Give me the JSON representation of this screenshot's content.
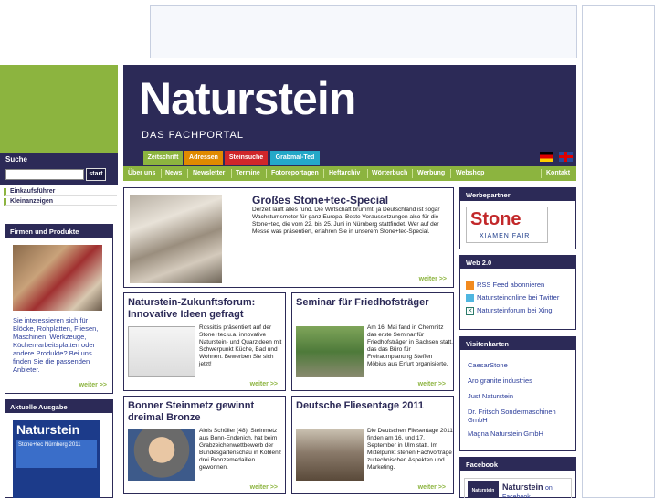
{
  "header": {
    "logo": "Naturstein",
    "subtitle": "DAS FACHPORTAL",
    "tabs": [
      {
        "label": "Zeitschrift",
        "color": "#8cb43f"
      },
      {
        "label": "Adressen",
        "color": "#e08a00"
      },
      {
        "label": "Steinsuche",
        "color": "#d0262a"
      },
      {
        "label": "Grabmal-Ted",
        "color": "#24a8c8"
      }
    ]
  },
  "nav": {
    "items": [
      "Über uns",
      "News",
      "Newsletter",
      "Termine",
      "Fotoreportagen",
      "Heftarchiv",
      "Wörterbuch",
      "Werbung",
      "Webshop"
    ],
    "contact": "Kontakt"
  },
  "left": {
    "search_title": "Suche",
    "search_button": "start",
    "quick_links": [
      "Einkaufsführer",
      "Kleinanzeigen"
    ],
    "firmen_title": "Firmen und Produkte",
    "firmen_text": "Sie interessieren sich für Blöcke, Rohplatten, Fliesen, Maschinen, Werkzeuge, Küchen-arbeitsplatten oder andere Produkte? Bei uns finden Sie die passenden Anbieter.",
    "firmen_more": "weiter >>",
    "ausgabe_title": "Aktuelle Ausgabe",
    "cover_title": "Naturstein",
    "cover_sub": "Stone+tec Nürnberg 2011"
  },
  "articles": {
    "feature": {
      "title": "Großes Stone+tec-Special",
      "text": "Derzeit läuft alles rund. Die Wirtschaft brummt, ja Deutschland ist sogar Wachstumsmotor für ganz Europa. Beste Voraussetzungen also für die Stone+tec, die vom 22. bis 25. Juni in Nürnberg stattfindet. Wer auf der Messe was präsentiert, erfahren Sie in unserem Stone+tec-Special.",
      "more": "weiter >>"
    },
    "cards": [
      {
        "title": "Naturstein-Zukunftsforum: Innovative Ideen gefragt",
        "text": "Rossittis präsentiert auf der Stone+tec u.a. innovative Naturstein- und Quarzideen mit Schwerpunkt Küche, Bad und Wohnen. Bewerben Sie sich jetzt!",
        "more": "weiter >>"
      },
      {
        "title": "Seminar für Friedhofsträger",
        "text": "Am 16. Mai fand in Chemnitz das erste Seminar für Friedhofsträger in Sachsen statt, das das Büro für Freiraumplanung Steffen Möbius aus Erfurt organisierte.",
        "more": "weiter >>"
      },
      {
        "title": "Bonner Steinmetz gewinnt dreimal Bronze",
        "text": "Alois Schüller (48), Steinmetz aus Bonn-Endenich, hat beim Grabzeichenwettbewerb der Bundesgartenschau in Koblenz drei Bronzemedaillen gewonnen.",
        "more": "weiter >>"
      },
      {
        "title": "Deutsche Fliesentage 2011",
        "text": "Die Deutschen Fliesentage 2011 finden am 16. und 17. September in Ulm statt. Im Mittelpunkt stehen Fachvorträge zu technischen Aspekten und Marketing.",
        "more": "weiter >>"
      }
    ]
  },
  "right": {
    "werbe_title": "Werbepartner",
    "stone_logo": "Stone",
    "stone_sub": "XIAMEN FAIR",
    "web20_title": "Web 2.0",
    "web20_items": [
      {
        "label": "RSS Feed abonnieren",
        "icon": "rss-icon"
      },
      {
        "label": "Natursteinonline bei Twitter",
        "icon": "twitter-icon"
      },
      {
        "label": "Natursteinforum bei Xing",
        "icon": "xing-icon"
      }
    ],
    "visit_title": "Visitenkarten",
    "visit_items": [
      "CaesarStone",
      "Aro granite industries",
      "Just Naturstein",
      "Dr. Fritsch Sondermaschinen GmbH",
      "Magna Naturstein GmbH"
    ],
    "fb_title": "Facebook",
    "fb_name": "Naturstein",
    "fb_on": "on Facebook",
    "fb_logo": "Naturstein"
  }
}
